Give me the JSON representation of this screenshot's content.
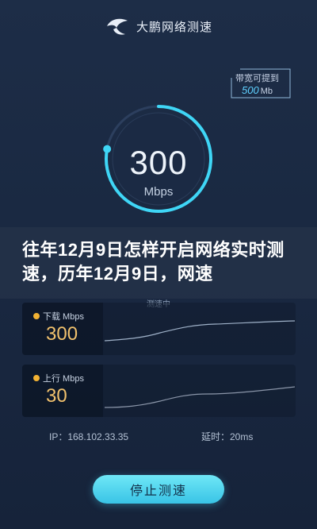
{
  "header": {
    "app_title": "大鹏网络测速",
    "logo_icon": "bird-logo-icon"
  },
  "bandwidth": {
    "line1": "带宽可提到",
    "value": "500",
    "unit": "Mb"
  },
  "gauge": {
    "value": "300",
    "unit": "Mbps",
    "progress": 0.78,
    "accent": "#3fd6f6"
  },
  "banner": {
    "text": "往年12月9日怎样开启网络实时测速，历年12月9日，网速"
  },
  "test_status": "测速中",
  "download": {
    "label": "下载 Mbps",
    "value": "300"
  },
  "upload": {
    "label": "上行 Mbps",
    "value": "30"
  },
  "info": {
    "ip": "IP：168.102.33.35",
    "latency": "延时：20ms"
  },
  "button": {
    "stop_label": "停止测速"
  },
  "colors": {
    "accent": "#3fd6f6",
    "value": "#f1c16d",
    "background": "#1a2942"
  }
}
